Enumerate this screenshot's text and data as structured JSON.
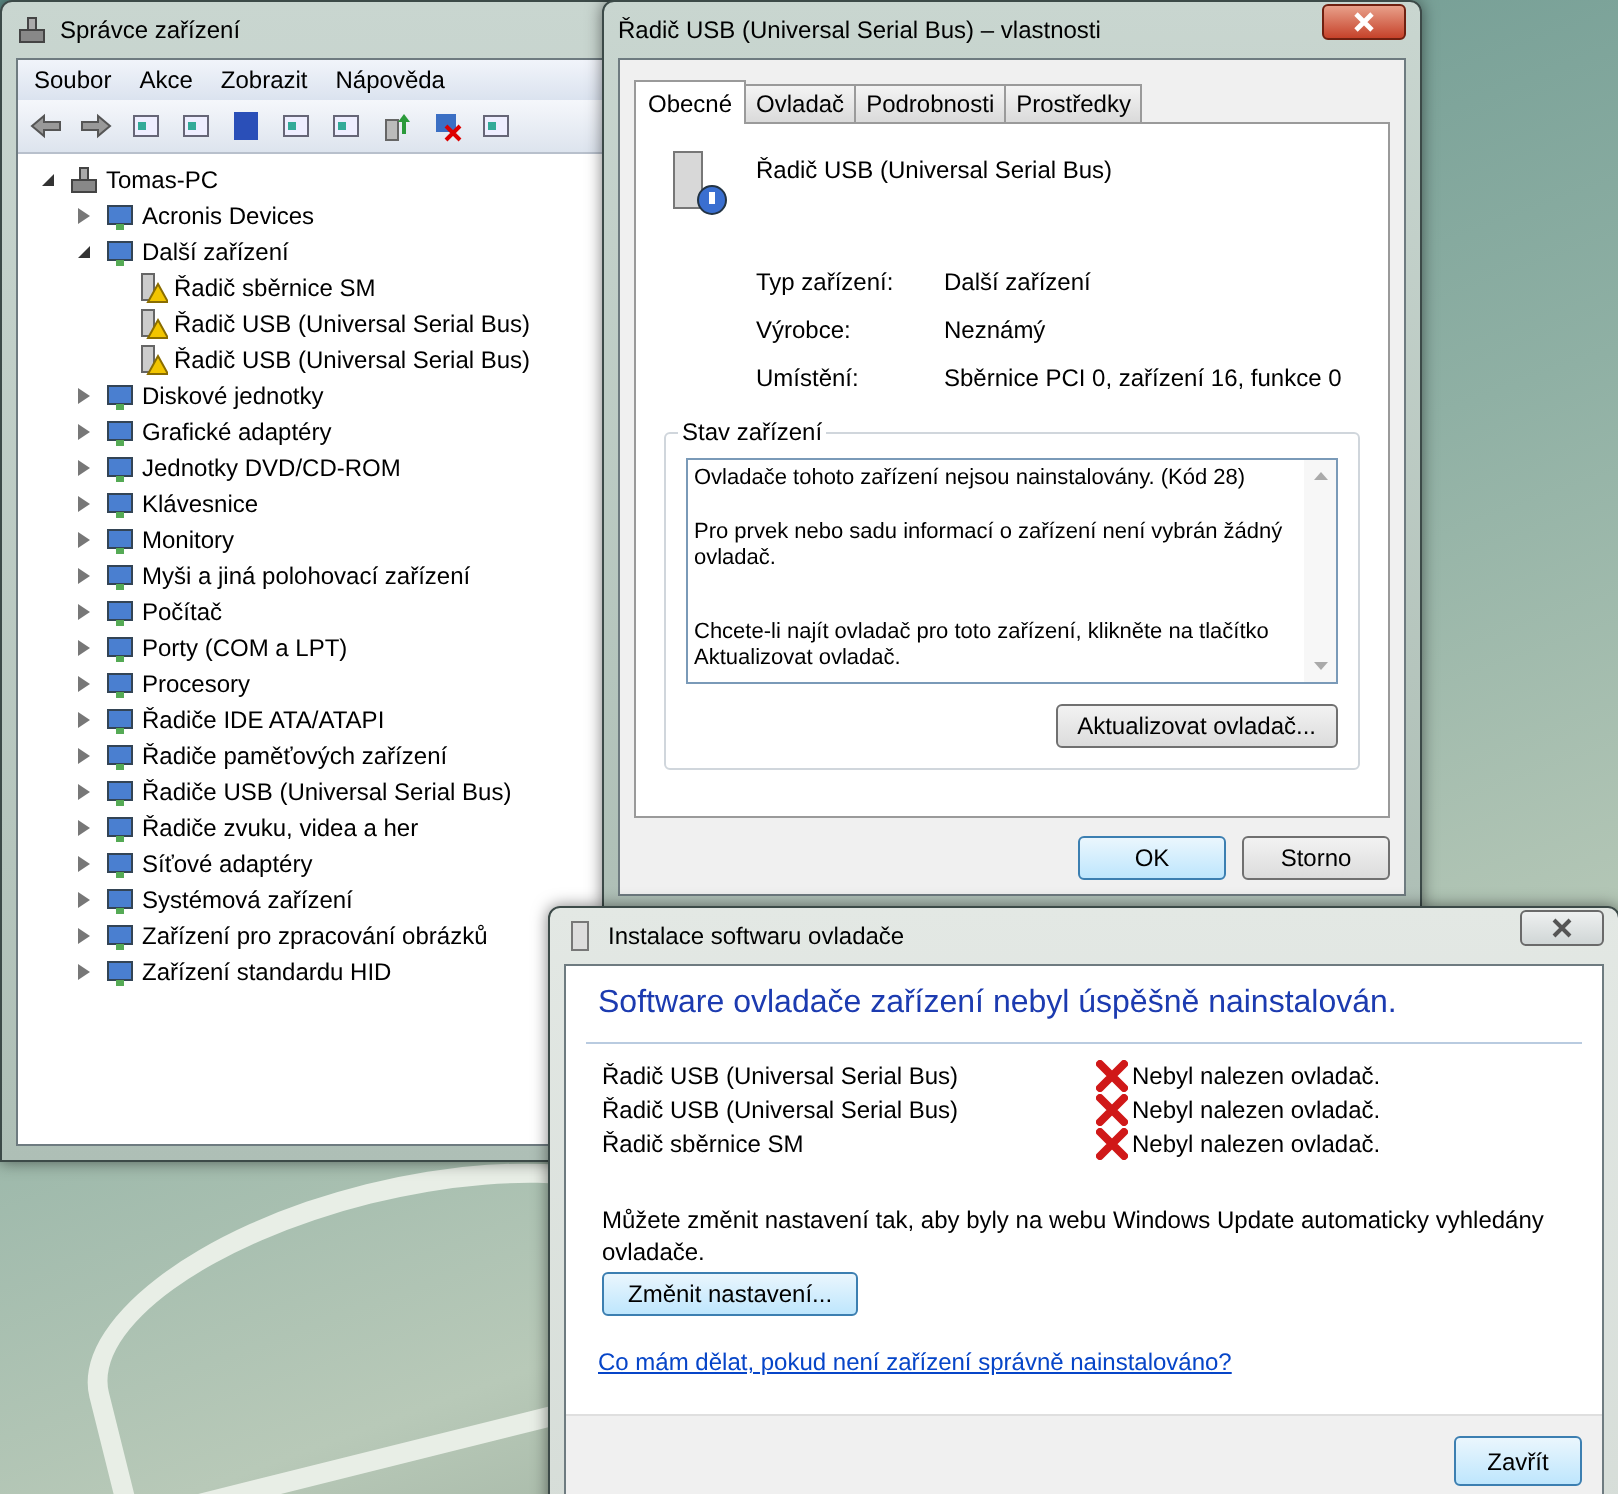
{
  "device_manager": {
    "title": "Správce zařízení",
    "menu": [
      "Soubor",
      "Akce",
      "Zobrazit",
      "Nápověda"
    ],
    "tree": {
      "label": "Tomas-PC",
      "expanded": true,
      "children": [
        {
          "label": "Acronis Devices",
          "expanded": false
        },
        {
          "label": "Další zařízení",
          "expanded": true,
          "children": [
            {
              "label": "Řadič sběrnice SM"
            },
            {
              "label": "Řadič USB (Universal Serial Bus)"
            },
            {
              "label": "Řadič USB (Universal Serial Bus)"
            }
          ]
        },
        {
          "label": "Diskové jednotky",
          "expanded": false
        },
        {
          "label": "Grafické adaptéry",
          "expanded": false
        },
        {
          "label": "Jednotky DVD/CD-ROM",
          "expanded": false
        },
        {
          "label": "Klávesnice",
          "expanded": false
        },
        {
          "label": "Monitory",
          "expanded": false
        },
        {
          "label": "Myši a jiná polohovací zařízení",
          "expanded": false
        },
        {
          "label": "Počítač",
          "expanded": false
        },
        {
          "label": "Porty (COM a LPT)",
          "expanded": false
        },
        {
          "label": "Procesory",
          "expanded": false
        },
        {
          "label": "Řadiče IDE ATA/ATAPI",
          "expanded": false
        },
        {
          "label": "Řadiče paměťových zařízení",
          "expanded": false
        },
        {
          "label": "Řadiče USB (Universal Serial Bus)",
          "expanded": false
        },
        {
          "label": "Řadiče zvuku, videa a her",
          "expanded": false
        },
        {
          "label": "Síťové adaptéry",
          "expanded": false
        },
        {
          "label": "Systémová zařízení",
          "expanded": false
        },
        {
          "label": "Zařízení pro zpracování obrázků",
          "expanded": false
        },
        {
          "label": "Zařízení standardu HID",
          "expanded": false
        }
      ]
    }
  },
  "properties": {
    "title": "Řadič USB (Universal Serial Bus) – vlastnosti",
    "tabs": [
      {
        "label": "Obecné",
        "selected": true
      },
      {
        "label": "Ovladač",
        "selected": false
      },
      {
        "label": "Podrobnosti",
        "selected": false
      },
      {
        "label": "Prostředky",
        "selected": false
      }
    ],
    "device_name": "Řadič USB (Universal Serial Bus)",
    "fields": [
      {
        "label": "Typ zařízení:",
        "value": "Další zařízení"
      },
      {
        "label": "Výrobce:",
        "value": "Neznámý"
      },
      {
        "label": "Umístění:",
        "value": "Sběrnice PCI 0, zařízení 16, funkce 0"
      }
    ],
    "status_group": "Stav zařízení",
    "status_text": [
      "Ovladače tohoto zařízení nejsou nainstalovány. (Kód 28)",
      "Pro prvek nebo sadu informací o zařízení není vybrán žádný ovladač.",
      "Chcete-li najít ovladač pro toto zařízení, klikněte na tlačítko Aktualizovat ovladač."
    ],
    "update_button": "Aktualizovat ovladač...",
    "ok_button": "OK",
    "cancel_button": "Storno"
  },
  "driver_install": {
    "title": "Instalace softwaru ovladače",
    "heading": "Software ovladače zařízení nebyl úspěšně nainstalován.",
    "results": [
      {
        "device": "Řadič USB (Universal Serial Bus)",
        "status": "Nebyl nalezen ovladač."
      },
      {
        "device": "Řadič USB (Universal Serial Bus)",
        "status": "Nebyl nalezen ovladač."
      },
      {
        "device": "Řadič sběrnice SM",
        "status": "Nebyl nalezen ovladač."
      }
    ],
    "info": "Můžete změnit nastavení tak, aby byly na webu Windows Update automaticky vyhledány ovladače.",
    "settings_button": "Změnit nastavení...",
    "help_link": "Co mám dělat, pokud není zařízení správně nainstalováno?",
    "close_button": "Zavřít"
  }
}
